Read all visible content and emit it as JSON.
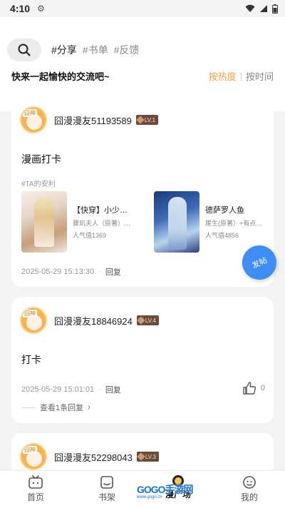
{
  "status_bar": {
    "time": "4:10",
    "gear_icon": "gear-icon",
    "wifi_icon": "wifi-icon",
    "signal_icon": "signal-icon",
    "battery_icon": "battery-icon"
  },
  "header": {
    "search_icon": "search-icon",
    "tags": [
      "#分享",
      "#书单",
      "#反馈"
    ],
    "subtitle": "快来一起愉快的交流吧~",
    "sort_hot": "按热度",
    "sort_sep": "|",
    "sort_time": "按时间"
  },
  "posts": [
    {
      "username": "囧漫漫友51193589",
      "level": "LV.1",
      "avatar_badge": "囧神",
      "text": "漫画打卡",
      "section_label": "#TA的安利",
      "books": [
        {
          "title": "【快穿】小少…",
          "author": "骤玑夫人（原著）+暮青…",
          "popularity": "人气值1369"
        },
        {
          "title": "德萨罗人鱼",
          "author": "崖生(原著）+有点笔札",
          "popularity": "人气值4856"
        }
      ],
      "date": "2025-05-29 15:13:30",
      "reply": "回复"
    },
    {
      "username": "囧漫漫友18846924",
      "level": "LV.4",
      "avatar_badge": "囧神",
      "text": "打卡",
      "date": "2025-05-29 15:01:01",
      "reply": "回复",
      "likes": "0",
      "view_replies": "查看1条回复"
    },
    {
      "username": "囧漫漫友52298043",
      "level": "LV.3",
      "avatar_badge": "囧神"
    }
  ],
  "fab": {
    "label": "发帖"
  },
  "nav": [
    {
      "label": "首页",
      "icon": "tv-icon"
    },
    {
      "label": "书架",
      "icon": "bookshelf-icon"
    },
    {
      "label": "漫广场",
      "icon": "plaza-icon"
    },
    {
      "label": "我的",
      "icon": "profile-icon"
    }
  ],
  "watermark": {
    "text": "GOGO手游网",
    "sub": "www.gogo.cn"
  },
  "colors": {
    "accent": "#f2a33a",
    "fab": "#3c8ef5",
    "level_badge": "#6d4a3c"
  }
}
